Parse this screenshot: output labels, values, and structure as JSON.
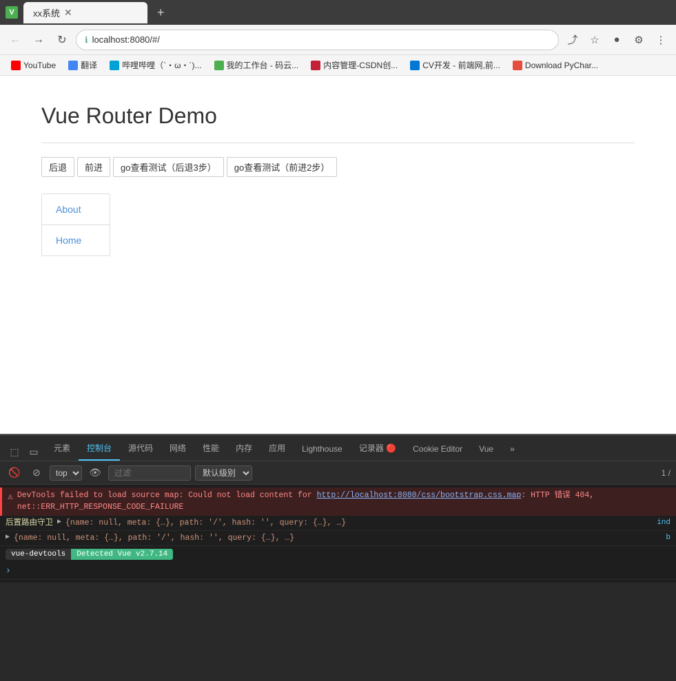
{
  "browser": {
    "title": "xx系统",
    "tab_label": "xx系统",
    "url": "localhost:8080/#/",
    "new_tab_symbol": "+"
  },
  "bookmarks": [
    {
      "id": "youtube",
      "label": "YouTube",
      "color": "#ff0000"
    },
    {
      "id": "translate",
      "label": "翻译",
      "color": "#4285f4"
    },
    {
      "id": "bilibili",
      "label": "哔哩哔哩（`・ω・´)...",
      "color": "#00a1d6"
    },
    {
      "id": "google-ext",
      "label": "我的工作台 - 码云...",
      "color": "#4CAF50"
    },
    {
      "id": "csdn",
      "label": "内容管理-CSDN创...",
      "color": "#c32136"
    },
    {
      "id": "cv",
      "label": "CV开发 - 前端网,前...",
      "color": "#0078d7"
    },
    {
      "id": "jetbrains",
      "label": "Download PyChar...",
      "color": "#e74c3c"
    }
  ],
  "page": {
    "title": "Vue Router Demo",
    "nav_buttons": [
      {
        "id": "back",
        "label": "后退"
      },
      {
        "id": "forward",
        "label": "前进"
      },
      {
        "id": "go-back-3",
        "label": "go查看测试（后退3步）"
      },
      {
        "id": "go-forward-2",
        "label": "go查看测试（前进2步）"
      }
    ],
    "router_links": [
      {
        "id": "about",
        "label": "About"
      },
      {
        "id": "home",
        "label": "Home"
      }
    ]
  },
  "devtools": {
    "tabs": [
      {
        "id": "elements",
        "label": "元素"
      },
      {
        "id": "console",
        "label": "控制台",
        "active": true
      },
      {
        "id": "sources",
        "label": "源代码"
      },
      {
        "id": "network",
        "label": "网络"
      },
      {
        "id": "performance",
        "label": "性能"
      },
      {
        "id": "memory",
        "label": "内存"
      },
      {
        "id": "application",
        "label": "应用"
      },
      {
        "id": "lighthouse",
        "label": "Lighthouse"
      },
      {
        "id": "recorder",
        "label": "记录器 🔴"
      },
      {
        "id": "cookie-editor",
        "label": "Cookie Editor"
      },
      {
        "id": "vue",
        "label": "Vue"
      }
    ],
    "toolbar": {
      "top_label": "top",
      "filter_placeholder": "过滤",
      "level_label": "默认级别",
      "page_number": "1 /"
    },
    "console_lines": [
      {
        "type": "error",
        "text": "DevTools failed to load source map: Could not load content for ",
        "link": "http://localhost:8080/css/bootstrap.css.map",
        "text2": ": HTTP 错误 404, net::ERR_HTTP_RESPONSE_CODE_FAILURE"
      }
    ],
    "log_lines": [
      {
        "type": "log",
        "prefix": "后置路由守卫",
        "expandable": true,
        "text": "{name: null, meta: {…}, path: '/', hash: '', query: {…}, …}"
      },
      {
        "type": "log",
        "expandable": true,
        "text": "{name: null, meta: {…}, path: '/', hash: '', query: {…}, …}"
      }
    ],
    "vue_badge": {
      "left": "vue-devtools",
      "right": "Detected Vue v2.7.14"
    }
  }
}
